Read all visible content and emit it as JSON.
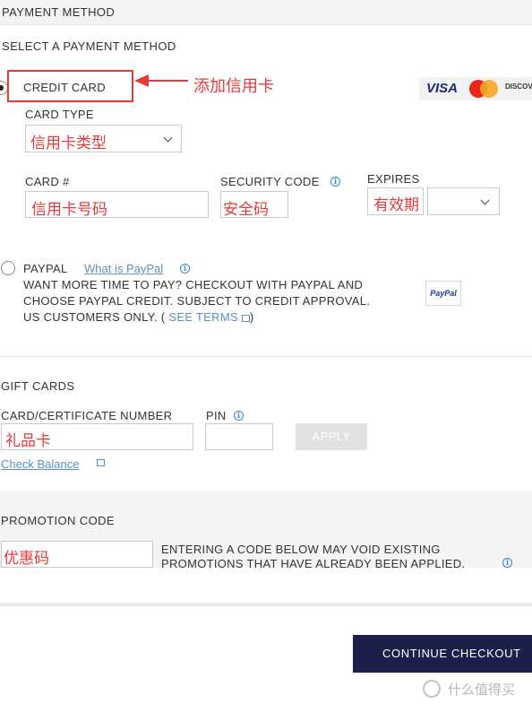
{
  "header": {
    "title": "PAYMENT METHOD"
  },
  "payment": {
    "section_title": "SELECT A PAYMENT METHOD",
    "credit_card": {
      "label": "CREDIT CARD",
      "selected": true,
      "annotation": "添加信用卡",
      "card_logos": [
        "VISA",
        "MasterCard",
        "DISCOVER"
      ],
      "card_type_label": "CARD TYPE",
      "card_type_value": "信用卡类型",
      "card_number_label": "CARD #",
      "card_number_value": "信用卡号码",
      "security_code_label": "SECURITY CODE",
      "security_code_value": "安全码",
      "expires_label": "EXPIRES",
      "expires_value": "有效期"
    },
    "paypal": {
      "label": "PAYPAL",
      "what_is_link": "What is PayPal",
      "desc_line1": "WANT MORE TIME TO PAY? CHECKOUT WITH PAYPAL AND",
      "desc_line2": "CHOOSE PAYPAL CREDIT. SUBJECT TO CREDIT APPROVAL.",
      "desc_line3_prefix": "US CUSTOMERS ONLY. (",
      "see_terms": "SEE TERMS",
      "desc_line3_suffix": ")",
      "badge": "PayPal"
    }
  },
  "gift_cards": {
    "title": "GIFT CARDS",
    "number_label": "CARD/CERTIFICATE NUMBER",
    "number_value": "礼品卡",
    "pin_label": "PIN",
    "apply_label": "APPLY",
    "check_balance": "Check Balance"
  },
  "promotion": {
    "title": "PROMOTION CODE",
    "value": "优惠码",
    "note_line1": "ENTERING A CODE BELOW MAY VOID EXISTING",
    "note_line2": "PROMOTIONS THAT HAVE ALREADY BEEN APPLIED."
  },
  "footer": {
    "continue_label": "CONTINUE CHECKOUT",
    "watermark": "什么值得买"
  },
  "colors": {
    "annotation_red": "#e43a3a",
    "link_blue": "#5a8fc0",
    "continue_bg": "#1e1e4a"
  }
}
